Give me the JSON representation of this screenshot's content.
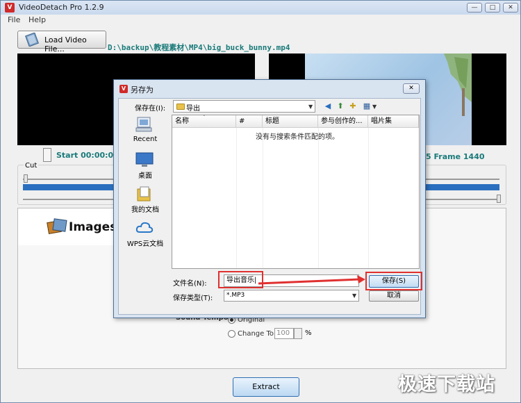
{
  "app": {
    "title": "VideoDetach Pro 1.2.9",
    "icon_letter": "V"
  },
  "window_controls": {
    "minimize": "—",
    "maximize": "□",
    "close": "✕"
  },
  "menu": [
    "File",
    "Help"
  ],
  "toolbar": {
    "load_button_label": "Load Video File...",
    "file_path": "D:\\backup\\教程素材\\MP4\\big_buck_bunny.mp4"
  },
  "timeline": {
    "start_text": "Start 00:00:00.",
    "frame_text": "5  Frame 1440",
    "cut_label": "Cut"
  },
  "tabs": {
    "images_label": "Images"
  },
  "sound": {
    "label": "Sound Tempo",
    "option_original": "Original",
    "option_change_to": "Change To",
    "tempo_value": "100",
    "percent": "%"
  },
  "extract_label": "Extract",
  "watermark": "极速下载站",
  "dialog": {
    "title": "另存为",
    "close": "✕",
    "save_in_label": "保存在(I):",
    "save_in_value": "导出",
    "places": [
      {
        "name": "recent",
        "label": "Recent"
      },
      {
        "name": "desktop",
        "label": "桌面"
      },
      {
        "name": "my-documents",
        "label": "我的文档"
      },
      {
        "name": "wps-cloud",
        "label": "WPS云文档"
      }
    ],
    "columns": [
      "名称",
      "#",
      "标题",
      "参与创作的...",
      "唱片集"
    ],
    "empty_message": "没有与搜索条件匹配的项。",
    "filename_label": "文件名(N):",
    "filename_value": "导出音乐|",
    "filetype_label": "保存类型(T):",
    "filetype_value": "*.MP3",
    "save_button": "保存(S)",
    "cancel_button": "取消"
  },
  "colors": {
    "accent_teal": "#1a7a7a",
    "highlight_red": "#e03030",
    "cut_bar_blue": "#2a6fbf"
  }
}
